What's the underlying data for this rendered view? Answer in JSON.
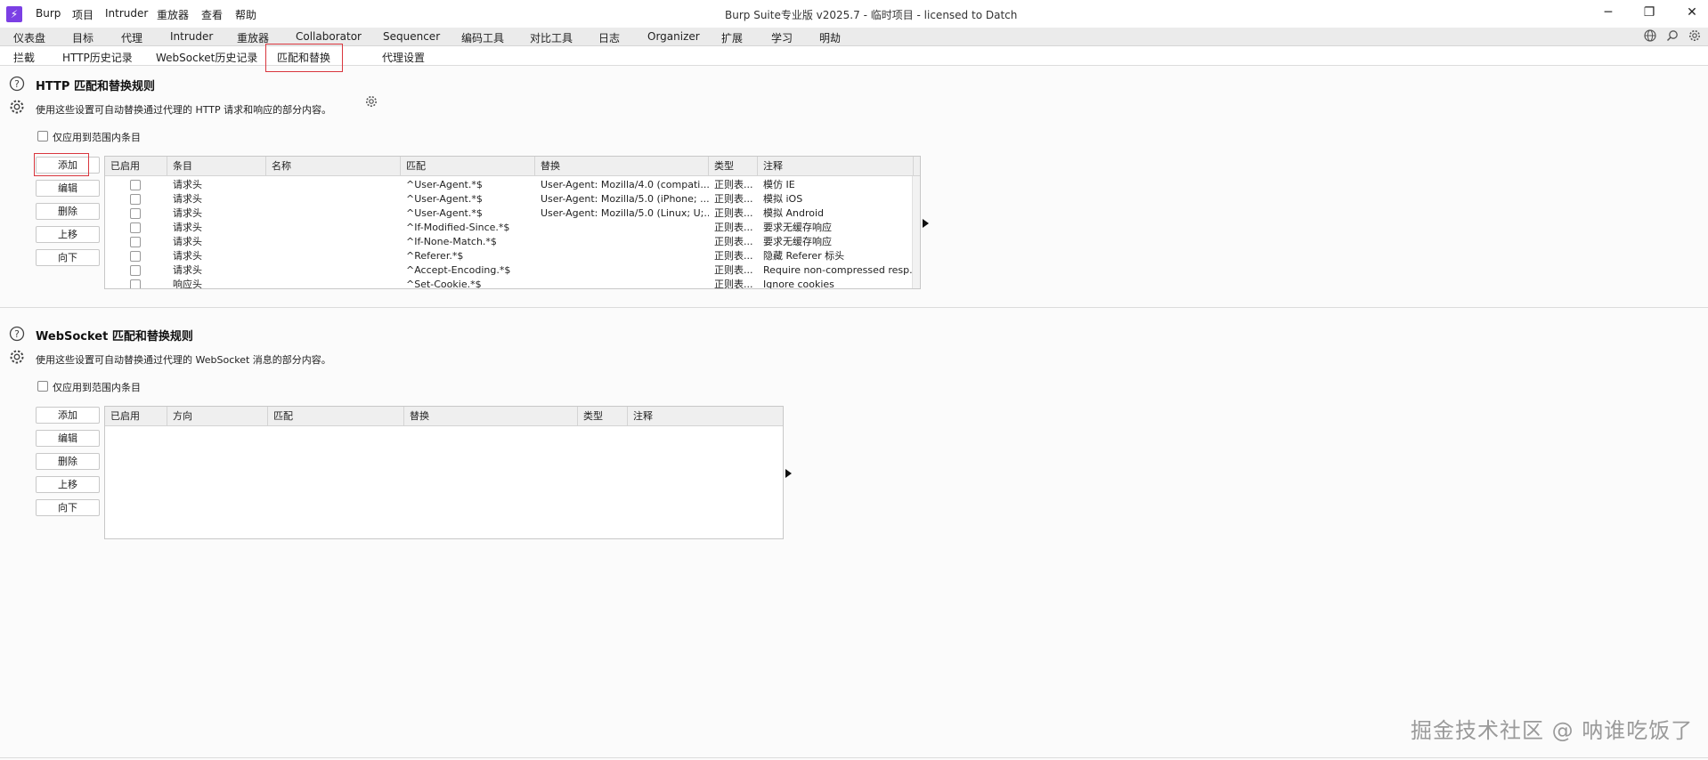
{
  "titlebar": {
    "logo": "⚡",
    "menus": [
      "Burp",
      "项目",
      "Intruder",
      "重放器",
      "查看",
      "帮助"
    ],
    "title": "Burp Suite专业版  v2025.7 - 临时项目 - licensed to Datch",
    "minimize": "─",
    "restore": "❐",
    "close": "✕"
  },
  "main_tabs": [
    "仪表盘",
    "目标",
    "代理",
    "Intruder",
    "重放器",
    "Collaborator",
    "Sequencer",
    "编码工具",
    "对比工具",
    "日志",
    "Organizer",
    "扩展",
    "学习",
    "明劫"
  ],
  "active_main_tab": "代理",
  "top_icons": [
    "globe-icon",
    "search-icon",
    "gear-icon"
  ],
  "sub_tabs": [
    "拦截",
    "HTTP历史记录",
    "WebSocket历史记录",
    "匹配和替换",
    "代理设置"
  ],
  "active_sub_tab": "匹配和替换",
  "http_section": {
    "title": "HTTP 匹配和替换规则",
    "description": "使用这些设置可自动替换通过代理的 HTTP 请求和响应的部分内容。",
    "scope_label": "仅应用到范围内条目",
    "buttons": [
      "添加",
      "编辑",
      "删除",
      "上移",
      "向下"
    ],
    "columns": [
      "已启用",
      "条目",
      "名称",
      "匹配",
      "替换",
      "类型",
      "注释"
    ],
    "rows": [
      {
        "item": "请求头",
        "name": "",
        "match": "^User-Agent.*$",
        "replace": "User-Agent: Mozilla/4.0 (compati...",
        "type": "正则表...",
        "comment": "模仿 IE"
      },
      {
        "item": "请求头",
        "name": "",
        "match": "^User-Agent.*$",
        "replace": "User-Agent: Mozilla/5.0 (iPhone; ...",
        "type": "正则表...",
        "comment": "模拟 iOS"
      },
      {
        "item": "请求头",
        "name": "",
        "match": "^User-Agent.*$",
        "replace": "User-Agent: Mozilla/5.0 (Linux; U;...",
        "type": "正则表...",
        "comment": "模拟 Android"
      },
      {
        "item": "请求头",
        "name": "",
        "match": "^If-Modified-Since.*$",
        "replace": "",
        "type": "正则表...",
        "comment": "要求无缓存响应"
      },
      {
        "item": "请求头",
        "name": "",
        "match": "^If-None-Match.*$",
        "replace": "",
        "type": "正则表...",
        "comment": "要求无缓存响应"
      },
      {
        "item": "请求头",
        "name": "",
        "match": "^Referer.*$",
        "replace": "",
        "type": "正则表...",
        "comment": "隐藏 Referer 标头"
      },
      {
        "item": "请求头",
        "name": "",
        "match": "^Accept-Encoding.*$",
        "replace": "",
        "type": "正则表...",
        "comment": "Require non-compressed resp..."
      },
      {
        "item": "响应头",
        "name": "",
        "match": "^Set-Cookie.*$",
        "replace": "",
        "type": "正则表...",
        "comment": "Ignore cookies"
      }
    ]
  },
  "ws_section": {
    "title": "WebSocket 匹配和替换规则",
    "description": "使用这些设置可自动替换通过代理的 WebSocket 消息的部分内容。",
    "scope_label": "仅应用到范围内条目",
    "buttons": [
      "添加",
      "编辑",
      "删除",
      "上移",
      "向下"
    ],
    "columns": [
      "已启用",
      "方向",
      "匹配",
      "替换",
      "类型",
      "注释"
    ]
  },
  "watermark": "掘金技术社区 @ 呐谁吃饭了"
}
